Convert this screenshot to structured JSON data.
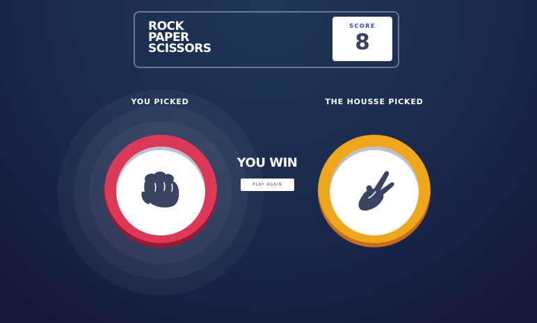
{
  "header": {
    "title_lines": [
      "ROCK",
      "PAPER",
      "SCISSORS"
    ],
    "score_label": "SCORE",
    "score_value": "8"
  },
  "game": {
    "you_picked_label": "YOU PICKED",
    "house_picked_label": "THE HOUSSE PICKED",
    "player_choice": "rock",
    "house_choice": "scissors",
    "result_text": "YOU WIN",
    "play_again_label": "PLAY AGAIN"
  },
  "colors": {
    "rock": "#dc2e4e",
    "scissors": "#eca922",
    "icon": "#3b4363",
    "score": "#3b4363",
    "score_label": "#2a45c2"
  },
  "icons": {
    "rock": "fist-icon",
    "scissors": "scissors-hand-icon"
  }
}
